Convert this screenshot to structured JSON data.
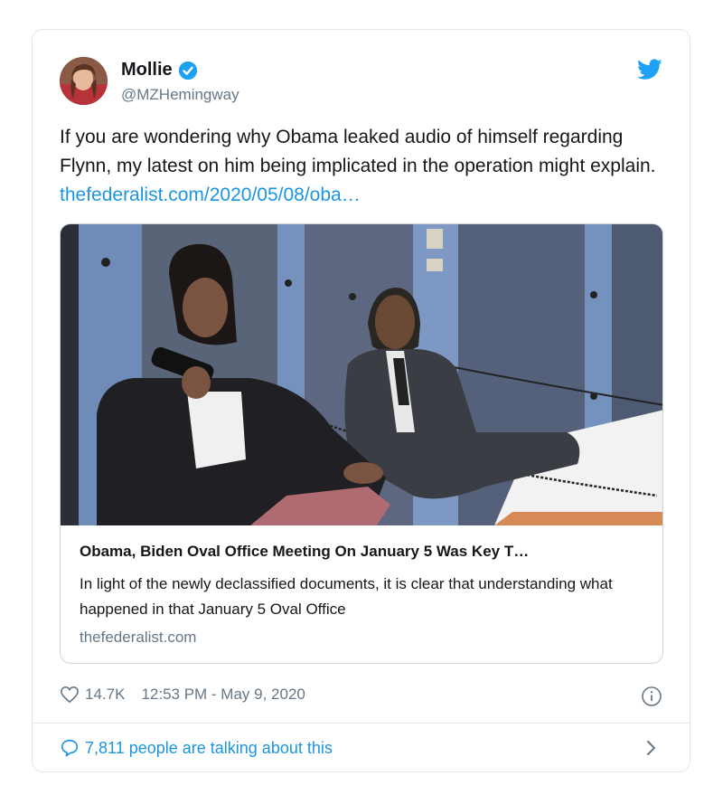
{
  "tweet": {
    "author": {
      "display_name": "Mollie",
      "handle": "@MZHemingway",
      "verified": true
    },
    "text": "If you are wondering why Obama leaked audio of himself regarding Flynn, my latest on him being implicated in the operation might explain.",
    "link_text": "thefederalist.com/2020/05/08/oba…",
    "card": {
      "title": "Obama, Biden Oval Office Meeting On January 5 Was Key T…",
      "description": "In light of the newly declassified documents, it is clear that understanding what happened in that January 5 Oval Office",
      "domain": "thefederalist.com"
    },
    "likes": "14.7K",
    "timestamp": "12:53 PM - May 9, 2020",
    "talking": "7,811 people are talking about this"
  },
  "colors": {
    "link": "#1b95e0",
    "secondary": "#657786",
    "border": "#e1e8ed"
  },
  "icons": [
    "twitter-bird-icon",
    "verified-badge-icon",
    "heart-icon",
    "info-icon",
    "speech-bubble-icon",
    "chevron-right-icon"
  ]
}
